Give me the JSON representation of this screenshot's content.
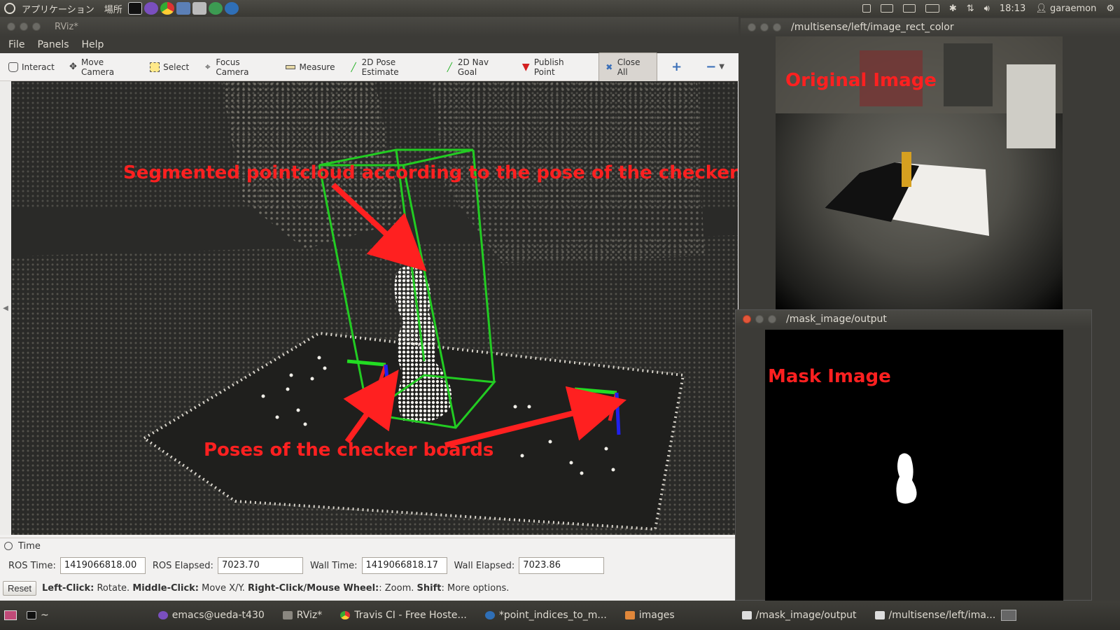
{
  "top_panel": {
    "applications_label": "アプリケーション",
    "places_label": "場所",
    "clock": "18:13",
    "user": "garaemon"
  },
  "rviz": {
    "title": "RViz*",
    "menus": [
      "File",
      "Panels",
      "Help"
    ],
    "tools": [
      {
        "label": "Interact",
        "icon": "hand-icon"
      },
      {
        "label": "Move Camera",
        "icon": "move-camera-icon"
      },
      {
        "label": "Select",
        "icon": "select-icon"
      },
      {
        "label": "Focus Camera",
        "icon": "focus-camera-icon"
      },
      {
        "label": "Measure",
        "icon": "measure-icon"
      },
      {
        "label": "2D Pose Estimate",
        "icon": "pose-estimate-icon"
      },
      {
        "label": "2D Nav Goal",
        "icon": "nav-goal-icon"
      },
      {
        "label": "Publish Point",
        "icon": "publish-point-icon"
      },
      {
        "label": "Close All",
        "icon": "close-all-icon"
      }
    ],
    "annotations": {
      "segmented": "Segmented pointcloud according to the pose of the checkerboard",
      "poses": "Poses of the checker boards"
    },
    "time_panel": {
      "title": "Time",
      "ros_time_label": "ROS Time:",
      "ros_time": "1419066818.00",
      "ros_elapsed_label": "ROS Elapsed:",
      "ros_elapsed": "7023.70",
      "wall_time_label": "Wall Time:",
      "wall_time": "1419066818.17",
      "wall_elapsed_label": "Wall Elapsed:",
      "wall_elapsed": "7023.86"
    },
    "status_bar": {
      "reset": "Reset",
      "left_click": "Left-Click:",
      "left_click_desc": " Rotate. ",
      "middle_click": "Middle-Click:",
      "middle_click_desc": " Move X/Y. ",
      "right_click": "Right-Click/Mouse Wheel:",
      "right_click_desc": ": Zoom. ",
      "shift": "Shift",
      "shift_desc": ": More options."
    }
  },
  "image_windows": {
    "original": {
      "title": "/multisense/left/image_rect_color",
      "label": "Original Image"
    },
    "mask": {
      "title": "/mask_image/output",
      "label": "Mask Image"
    }
  },
  "taskbar": {
    "items": [
      {
        "label": "~"
      },
      {
        "label": "emacs@ueda-t430"
      },
      {
        "label": "RViz*"
      },
      {
        "label": "Travis CI - Free Hoste..."
      },
      {
        "label": "*point_indices_to_m..."
      },
      {
        "label": "images"
      },
      {
        "label": "/mask_image/output"
      },
      {
        "label": "/multisense/left/ima..."
      }
    ]
  },
  "colors": {
    "annotation": "#ff2020",
    "bbox": "#22cc22"
  }
}
